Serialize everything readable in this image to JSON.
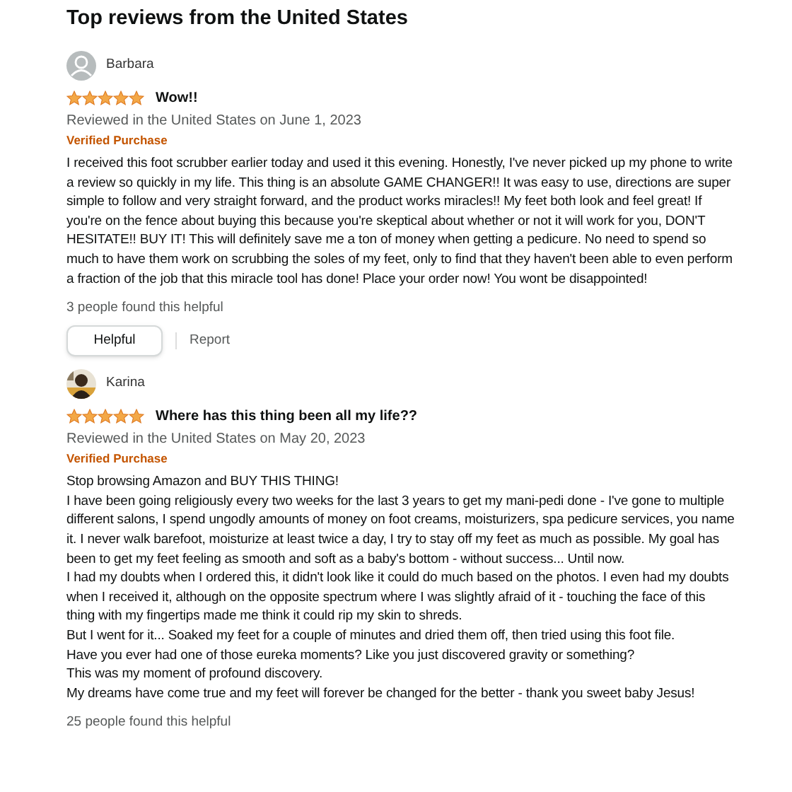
{
  "heading": "Top reviews from the United States",
  "reviews": [
    {
      "author": "Barbara",
      "avatar": {
        "kind": "silhouette"
      },
      "stars": 5,
      "title": "Wow!!",
      "meta": "Reviewed in the United States on June 1, 2023",
      "badge": "Verified Purchase",
      "body": [
        "I received this foot scrubber earlier today and used it this evening. Honestly, I've never picked up my phone to write a review so quickly in my life. This thing is an absolute GAME CHANGER!! It was easy to use, directions are super simple to follow and very straight forward, and the product works miracles!! My feet both look and feel great! If you're on the fence about buying this because you're skeptical about whether or not it will work for you, DON'T HESITATE!! BUY IT! This will definitely save me a ton of money when getting a pedicure. No need to spend so much to have them work on scrubbing the soles of my feet, only to find that they haven't been able to even perform a fraction of the job that this miracle tool has done! Place your order now! You wont be disappointed!"
      ],
      "helpful_count": "3 people found this helpful",
      "actions": [
        "Helpful",
        "Report"
      ]
    },
    {
      "author": "Karina",
      "stars": 5,
      "title": "Where has this thing been all my life??",
      "meta": "Reviewed in the United States on May 20, 2023",
      "badge": "Verified Purchase",
      "body": [
        "Stop browsing Amazon and BUY THIS THING!",
        "I have been going religiously every two weeks for the last 3 years to get my mani-pedi done - I've gone to multiple different salons, I spend ungodly amounts of money on foot creams, moisturizers, spa pedicure services, you name it. I never walk barefoot, moisturize at least twice a day, I try to stay off my feet as much as possible. My goal has been to get my feet feeling as smooth and soft as a baby's bottom - without success... Until now.",
        "I had my doubts when I ordered this, it didn't look like it could do much based on the photos. I even had my doubts when I received it, although on the opposite spectrum where I was slightly afraid of it - touching the face of this thing with my fingertips made me think it could rip my skin to shreds.",
        "But I went for it... Soaked my feet for a couple of minutes and dried them off, then tried using this foot file.",
        "Have you ever had one of those eureka moments? Like you just discovered gravity or something?",
        "This was my moment of profound discovery.",
        "My dreams have come true and my feet will forever be changed for the better - thank you sweet baby Jesus!"
      ],
      "helpful_count": "25 people found this helpful"
    }
  ]
}
